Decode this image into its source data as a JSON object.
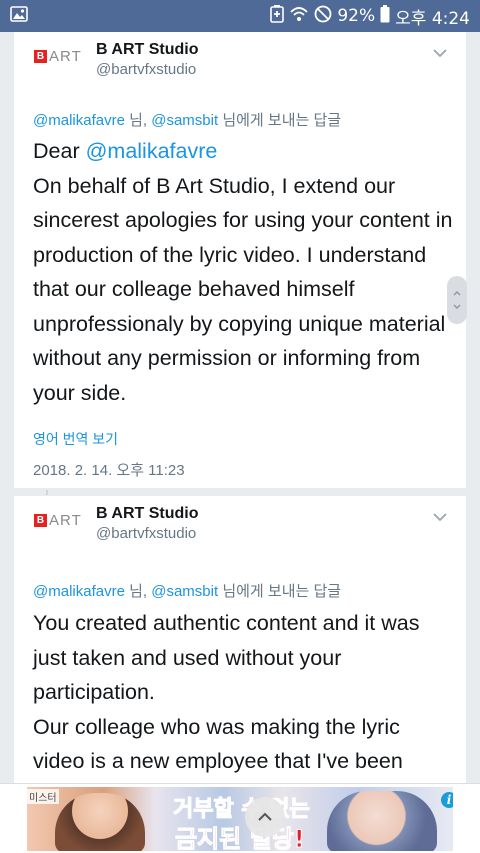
{
  "status_bar": {
    "battery": "92%",
    "time": "오후 4:24",
    "icons": [
      "gallery-icon",
      "battery-saver-icon",
      "wifi-icon",
      "do-not-disturb-icon"
    ]
  },
  "tweets": [
    {
      "display_name": "B ART Studio",
      "handle": "@bartvfxstudio",
      "avatar_logo_text": "ART",
      "reply_mention_1": "@malikafavre",
      "reply_sep_1": " 님, ",
      "reply_mention_2": "@samsbit",
      "reply_suffix": " 님에게 보내는 답글",
      "body_greeting": "Dear ",
      "body_greeting_mention": "@malikafavre",
      "body_text": "On behalf of B Art Studio, I extend our sincerest apologies for using your content in production of the lyric video. I understand that our colleage behaved himself unprofessionaly by copying unique material without any permission or informing from your side.",
      "translate_label": "영어 번역 보기",
      "timestamp": "2018. 2. 14. 오후 11:23"
    },
    {
      "display_name": "B ART Studio",
      "handle": "@bartvfxstudio",
      "avatar_logo_text": "ART",
      "reply_mention_1": "@malikafavre",
      "reply_sep_1": " 님, ",
      "reply_mention_2": "@samsbit",
      "reply_suffix": " 님에게 보내는 답글",
      "body_line_1": "You created authentic content and it was just taken and used without your participation.",
      "body_line_2": "Our colleage who was making the lyric video is a new employee that I've been"
    }
  ],
  "ad": {
    "brand": "미스터",
    "headline_1": "거부할 수 없는",
    "headline_2": "금지된 밀당!",
    "info_label": "i"
  },
  "colors": {
    "status_bar": "#4f6a96",
    "mention": "#1b95e0",
    "secondary_text": "#657786",
    "ad_headline": "#e8202d"
  }
}
